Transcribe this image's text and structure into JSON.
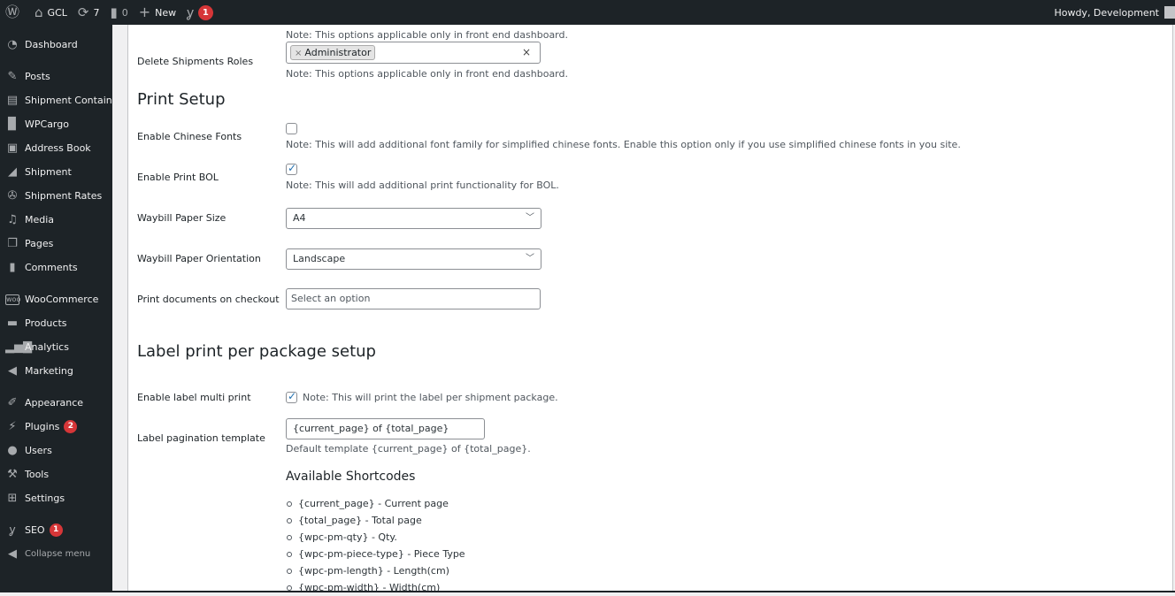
{
  "adminbar": {
    "site_name": "GCL",
    "updates_count": "7",
    "comments_count": "0",
    "new_label": "New",
    "seo_badge": "1",
    "howdy": "Howdy, Development"
  },
  "sidebar": {
    "items": [
      {
        "label": "Dashboard",
        "icon": "dashboard-icon"
      },
      {
        "label": "Posts",
        "icon": "pin-icon"
      },
      {
        "label": "Shipment Container",
        "icon": "container-icon"
      },
      {
        "label": "WPCargo",
        "icon": "book-icon"
      },
      {
        "label": "Address Book",
        "icon": "address-book-icon"
      },
      {
        "label": "Shipment",
        "icon": "truck-icon"
      },
      {
        "label": "Shipment Rates",
        "icon": "rates-icon"
      },
      {
        "label": "Media",
        "icon": "media-icon"
      },
      {
        "label": "Pages",
        "icon": "pages-icon"
      },
      {
        "label": "Comments",
        "icon": "comment-icon"
      },
      {
        "label": "WooCommerce",
        "icon": "woo-icon"
      },
      {
        "label": "Products",
        "icon": "archive-icon"
      },
      {
        "label": "Analytics",
        "icon": "chart-bar-icon"
      },
      {
        "label": "Marketing",
        "icon": "megaphone-icon"
      },
      {
        "label": "Appearance",
        "icon": "paintbrush-icon"
      },
      {
        "label": "Plugins",
        "icon": "plug-icon",
        "badge": "2"
      },
      {
        "label": "Users",
        "icon": "user-icon"
      },
      {
        "label": "Tools",
        "icon": "wrench-icon"
      },
      {
        "label": "Settings",
        "icon": "settings-icon"
      },
      {
        "label": "SEO",
        "icon": "yoast-icon",
        "badge": "1"
      }
    ],
    "collapse_label": "Collapse menu"
  },
  "content": {
    "top_note": "Note: This options applicable only in front end dashboard.",
    "delete_roles": {
      "label": "Delete Shipments Roles",
      "selected_tag": "Administrator",
      "clear": "×",
      "note": "Note: This options applicable only in front end dashboard."
    },
    "print_setup": {
      "title": "Print Setup",
      "chinese_fonts": {
        "label": "Enable Chinese Fonts",
        "checked": false,
        "note": "Note: This will add additional font family for simplified chinese fonts. Enable this option only if you use simplified chinese fonts in you site."
      },
      "print_bol": {
        "label": "Enable Print BOL",
        "checked": true,
        "note": "Note: This will add additional print functionality for BOL."
      },
      "paper_size": {
        "label": "Waybill Paper Size",
        "value": "A4"
      },
      "paper_orientation": {
        "label": "Waybill Paper Orientation",
        "value": "Landscape"
      },
      "print_on_checkout": {
        "label": "Print documents on checkout",
        "placeholder": "Select an option"
      }
    },
    "label_print": {
      "title": "Label print per package setup",
      "multi_print": {
        "label": "Enable label multi print",
        "checked": true,
        "note": "Note: This will print the label per shipment package."
      },
      "pagination": {
        "label": "Label pagination template",
        "value": "{current_page} of {total_page}",
        "note": "Default template {current_page} of {total_page}."
      },
      "shortcodes_title": "Available Shortcodes",
      "shortcodes": [
        "{current_page} - Current page",
        "{total_page} - Total page",
        "{wpc-pm-qty} - Qty.",
        "{wpc-pm-piece-type} - Piece Type",
        "{wpc-pm-length} - Length(cm)",
        "{wpc-pm-width} - Width(cm)"
      ]
    }
  }
}
